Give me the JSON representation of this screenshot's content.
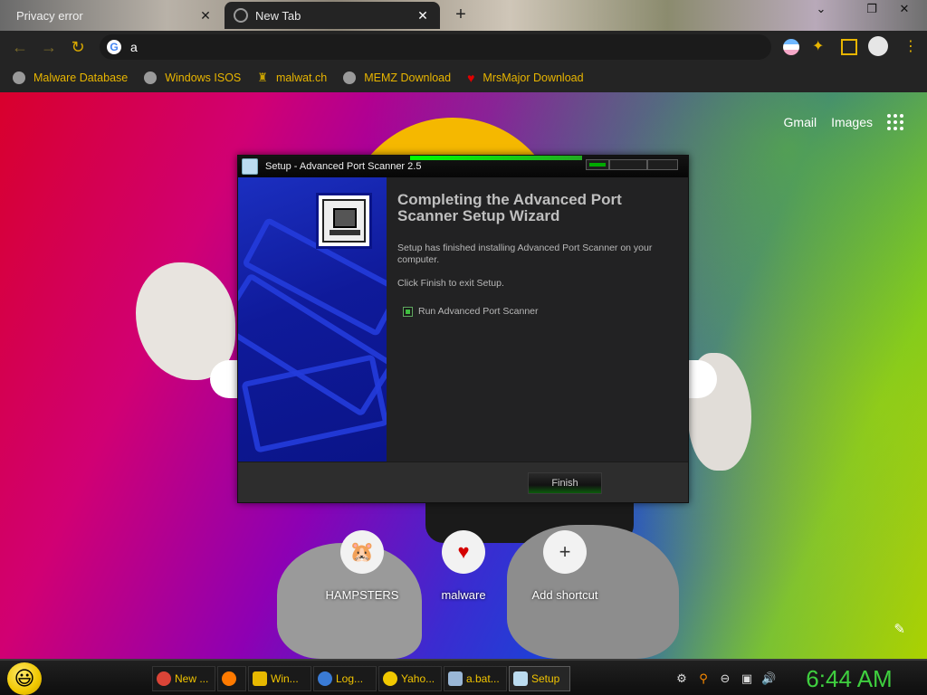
{
  "browser": {
    "tabs": [
      {
        "label": "Privacy error",
        "active": false
      },
      {
        "label": "New Tab",
        "active": true
      }
    ],
    "new_tab_symbol": "+",
    "close_symbol": "✕",
    "window_controls": {
      "minimize": "⌄",
      "restore": "❐",
      "close": "✕"
    },
    "omnibox_text": "a",
    "bookmarks": [
      {
        "label": "Malware Database",
        "icon": "globe-icon"
      },
      {
        "label": "Windows ISOS",
        "icon": "globe-icon"
      },
      {
        "label": "malwat.ch",
        "icon": "rat-icon"
      },
      {
        "label": "MEMZ Download",
        "icon": "globe-icon"
      },
      {
        "label": "MrsMajor Download",
        "icon": "heart-icon"
      }
    ]
  },
  "newtab": {
    "links": {
      "gmail": "Gmail",
      "images": "Images"
    },
    "shortcuts": [
      {
        "name": "HAMPSTERS",
        "icon": "hamster-icon"
      },
      {
        "name": "malware",
        "icon": "heart-icon"
      },
      {
        "name": "Add shortcut",
        "icon": "plus-icon"
      }
    ]
  },
  "dialog": {
    "title": "Setup - Advanced Port Scanner 2.5",
    "heading": "Completing the Advanced Port Scanner Setup Wizard",
    "text1": "Setup has finished installing Advanced Port Scanner on your computer.",
    "text2": "Click Finish to exit Setup.",
    "checkbox_label": "Run Advanced Port Scanner",
    "checkbox_checked": true,
    "finish_label": "Finish"
  },
  "taskbar": {
    "tasks": [
      {
        "label": "New ...",
        "icon": "chrome-icon",
        "color": "#db4437"
      },
      {
        "label": "",
        "icon": "firefox-icon",
        "color": "#ff7a00"
      },
      {
        "label": "Win...",
        "icon": "folder-icon",
        "color": "#e6b800"
      },
      {
        "label": "Log...",
        "icon": "network-icon",
        "color": "#3a7bd5"
      },
      {
        "label": "Yaho...",
        "icon": "smiley-icon",
        "color": "#f0c800"
      },
      {
        "label": "a.bat...",
        "icon": "notepad-icon",
        "color": "#9ab7d6"
      },
      {
        "label": "Setup",
        "icon": "setup-icon",
        "color": "#bcdcf0"
      }
    ],
    "clock": "6:44 AM"
  },
  "colors": {
    "accent": "#e8b500",
    "dialog_bg": "#222223",
    "clock_green": "#3fcf3f"
  }
}
